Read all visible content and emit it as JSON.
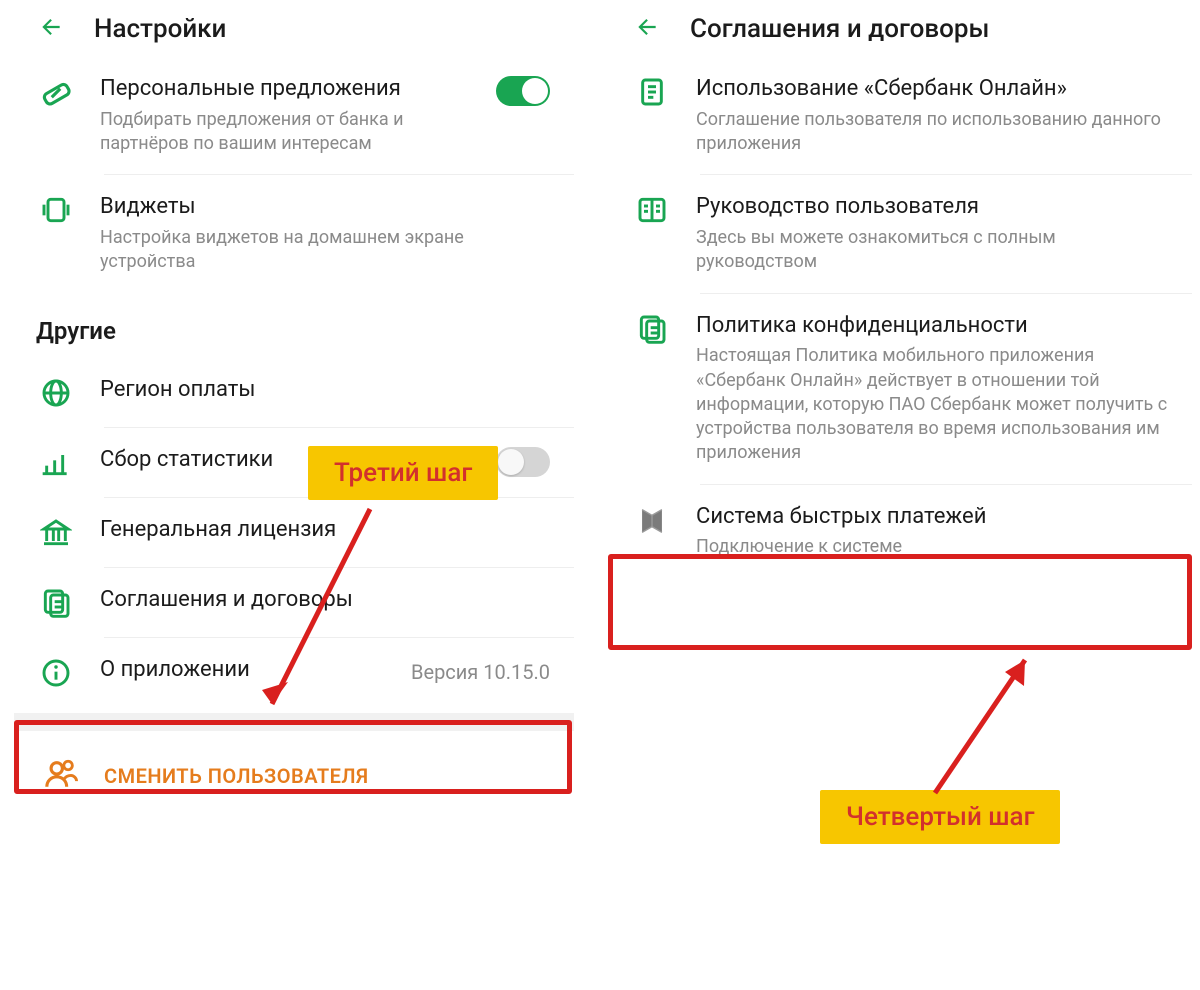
{
  "left": {
    "title": "Настройки",
    "personal": {
      "title": "Персональные предложения",
      "sub": "Подбирать предложения от банка и партнёров по вашим интересам",
      "on": true
    },
    "widgets": {
      "title": "Виджеты",
      "sub": "Настройка виджетов на домашнем экране устройства"
    },
    "section_other": "Другие",
    "region": {
      "title": "Регион оплаты"
    },
    "stats": {
      "title": "Сбор статистики",
      "on": false
    },
    "license": {
      "title": "Генеральная лицензия"
    },
    "agreements": {
      "title": "Соглашения и договоры"
    },
    "about": {
      "title": "О приложении",
      "version": "Версия 10.15.0"
    },
    "switch_user": "СМЕНИТЬ ПОЛЬЗОВАТЕЛЯ"
  },
  "right": {
    "title": "Соглашения и договоры",
    "sbo": {
      "title": "Использование «Сбербанк Онлайн»",
      "sub": "Соглашение пользователя по использованию данного приложения"
    },
    "manual": {
      "title": "Руководство пользователя",
      "sub": "Здесь вы можете ознакомиться с полным руководством"
    },
    "privacy": {
      "title": "Политика конфиденциальности",
      "sub": "Настоящая Политика мобильного приложения «Сбербанк Онлайн» действует в отношении той информации, которую ПАО Сбербанк может получить с устройства пользователя во время использования им приложения"
    },
    "sbp": {
      "title": "Система быстрых платежей",
      "sub": "Подключение к системе"
    }
  },
  "annotations": {
    "step3": "Третий шаг",
    "step4": "Четвертый шаг"
  }
}
